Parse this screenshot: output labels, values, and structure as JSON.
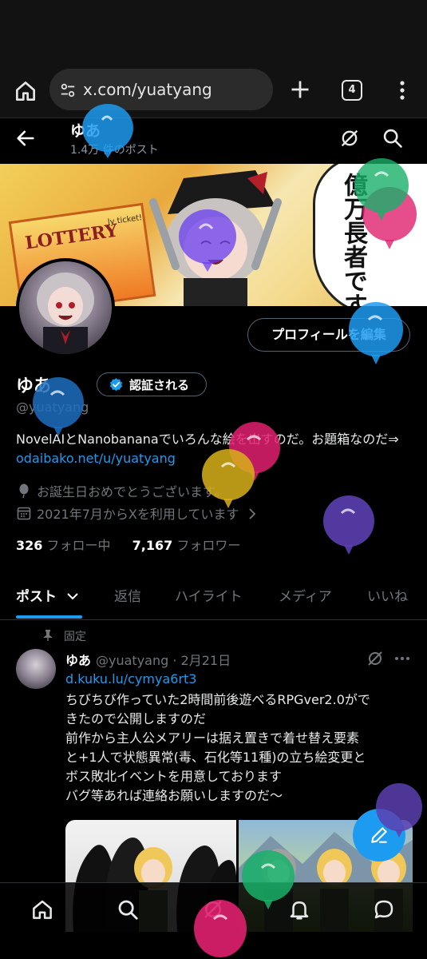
{
  "browser": {
    "url": "x.com/yuatyang",
    "tab_count": "4"
  },
  "header": {
    "name": "ゆあ",
    "post_count": "1.4万 件のポスト"
  },
  "banner": {
    "lottery_text": "LOTTERY",
    "ticket_text": "ly ticket!",
    "speech_text": "億万長者です！やったー！"
  },
  "profile": {
    "edit_button": "プロフィールを編集",
    "name": "ゆあ",
    "verified_label": "認証される",
    "handle": "@yuatyang",
    "bio_text": "NovelAIとNanobananaでいろんな絵を出すのだ。お題箱なのだ⇒ ",
    "bio_link": "odaibako.net/u/yuatyang",
    "birthday_text": "お誕生日おめでとうございます。",
    "joined_text": "2021年7月からXを利用しています",
    "following_count": "326",
    "following_label": "フォロー中",
    "followers_count": "7,167",
    "followers_label": "フォロワー"
  },
  "tabs": [
    {
      "label": "ポスト"
    },
    {
      "label": "返信"
    },
    {
      "label": "ハイライト"
    },
    {
      "label": "メディア"
    },
    {
      "label": "いいね"
    }
  ],
  "post": {
    "pinned_label": "固定",
    "author": "ゆあ",
    "handle_date": "@yuatyang · 2月21日",
    "link": "d.kuku.lu/cymya6rt3",
    "body_lines": [
      "ちびちび作っていた2時間前後遊べるRPGver2.0がで",
      "きたので公開しますのだ",
      "前作から主人公メアリーは据え置きで着せ替え要素",
      "と+1人で状態異常(毒、石化等11種)の立ち絵変更と",
      "ボス敗北イベントを用意しております",
      "バグ等あれば連絡お願いしますのだ〜"
    ]
  },
  "icons": {
    "home": "home-icon",
    "tune": "tune-icon",
    "plus": "plus-icon",
    "menu": "more-vertical-icon",
    "back": "back-arrow-icon",
    "grok": "grok-icon",
    "search": "search-icon",
    "verified": "verified-badge-icon",
    "balloon": "balloon-icon",
    "calendar": "calendar-icon",
    "pin": "pin-icon",
    "compose": "compose-icon",
    "notifications": "bell-icon",
    "messages": "message-icon"
  },
  "colors": {
    "accent": "#1d9bf0",
    "background": "#000000",
    "balloon_blue": "#1d9bf0",
    "balloon_purple": "#5b3fb0",
    "balloon_pink": "#e0206e",
    "balloon_green": "#19b06a",
    "balloon_yellow": "#d8b01a"
  }
}
